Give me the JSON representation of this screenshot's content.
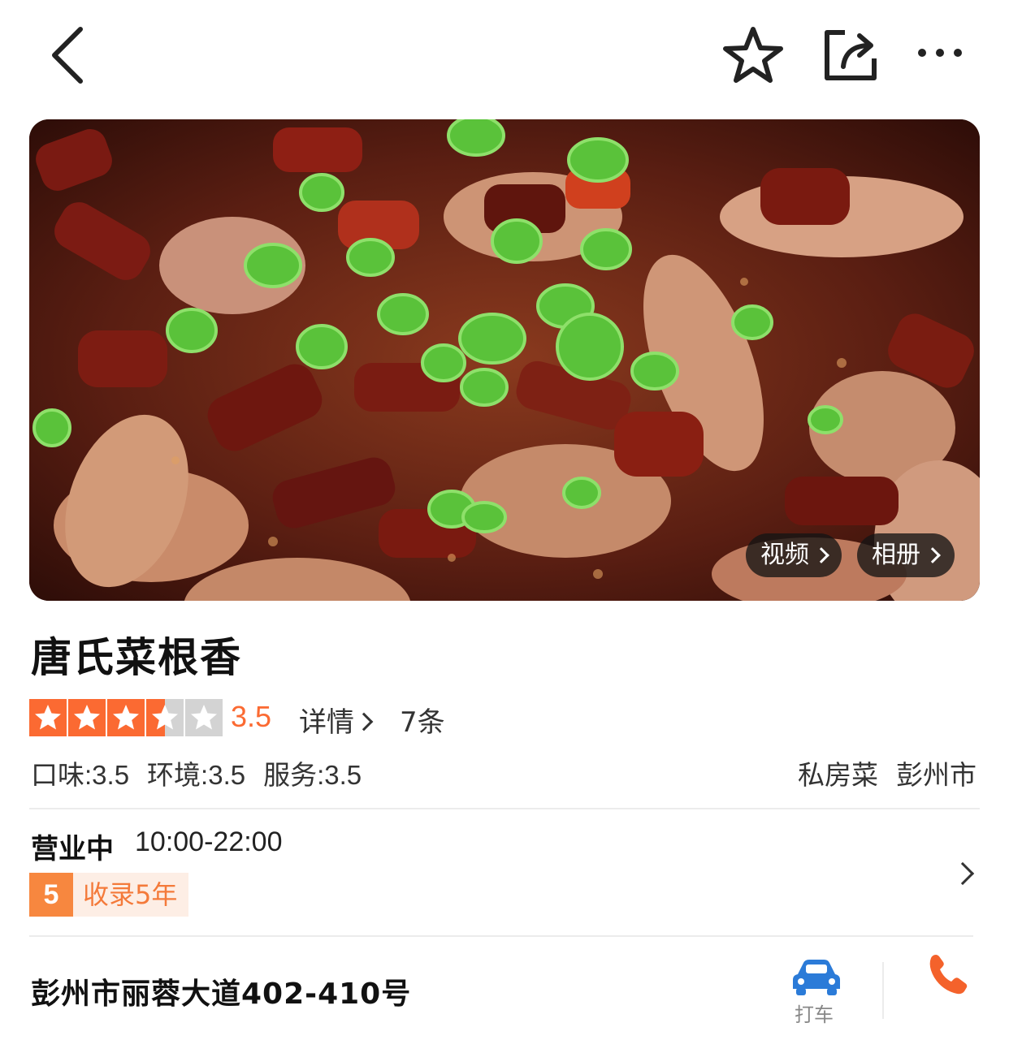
{
  "hero": {
    "video_label": "视频",
    "album_label": "相册"
  },
  "shop": {
    "name": "唐氏菜根香",
    "rating": "3.5",
    "rating_value": 3.5,
    "rating_max": 5,
    "detail_label": "详情",
    "review_count": "7条",
    "scores": {
      "taste": "口味:3.5",
      "environment": "环境:3.5",
      "service": "服务:3.5"
    },
    "category": "私房菜",
    "city": "彭州市",
    "status": "营业中",
    "hours": "10:00-22:00",
    "badge_number": "5",
    "badge_text": "收录5年",
    "address": "彭州市丽蓉大道402-410号",
    "taxi_label": "打车"
  },
  "colors": {
    "accent": "#fb6a32",
    "badge": "#f7873f",
    "taxi": "#2b7bd8",
    "phone": "#f4622b"
  }
}
